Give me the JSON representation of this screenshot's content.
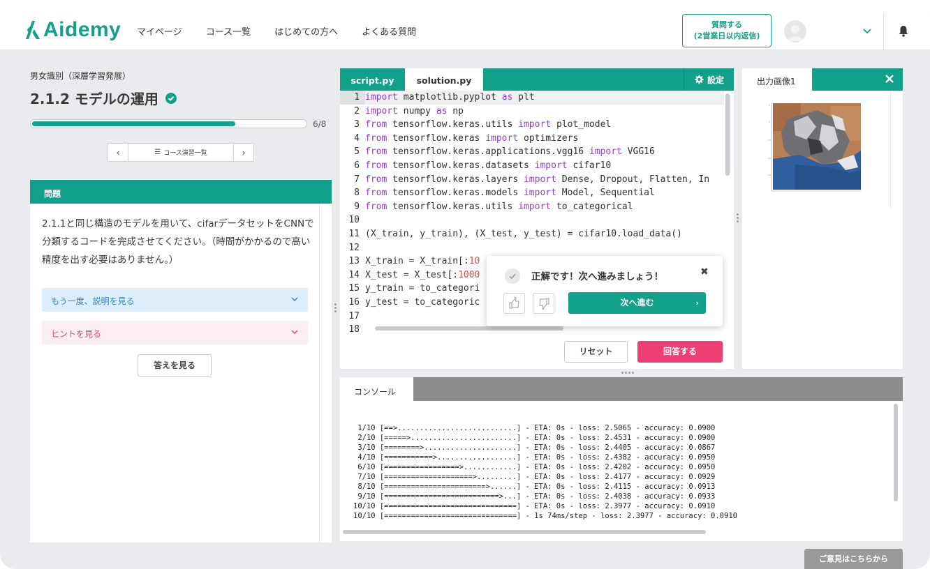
{
  "header": {
    "logo_text": "Aidemy",
    "nav": [
      "マイページ",
      "コース一覧",
      "はじめての方へ",
      "よくある質問"
    ],
    "ask_button": {
      "line1": "質問する",
      "line2": "(2営業日以内返信)"
    },
    "icons": {
      "user": "chevron-down-icon",
      "notify": "bell-icon"
    }
  },
  "lesson": {
    "breadcrumb": "男女識別（深層学習発展）",
    "title": "2.1.2 モデルの運用",
    "progress": {
      "current": 6,
      "total": 8,
      "label": "6/8",
      "fraction": 0.74
    },
    "pager": {
      "prev": "‹",
      "list_label": "コース演習一覧",
      "next": "›"
    }
  },
  "problem": {
    "heading": "問題",
    "text": "2.1.1と同じ構造のモデルを用いて、cifarデータセットをCNNで分類するコードを完成させてください。（時間がかかるので高い精度を出す必要はありません。）",
    "explain_label": "もう一度、説明を見る",
    "hint_label": "ヒントを見る",
    "answer_button": "答えを見る"
  },
  "editor": {
    "tabs": [
      "script.py",
      "solution.py"
    ],
    "settings_label": "設定",
    "lines": [
      {
        "n": "1",
        "segs": [
          [
            "kw",
            "import"
          ],
          [
            "plain",
            " matplotlib.pyplot "
          ],
          [
            "kw",
            "as"
          ],
          [
            "plain",
            " plt"
          ]
        ]
      },
      {
        "n": "2",
        "segs": [
          [
            "kw",
            "import"
          ],
          [
            "plain",
            " numpy "
          ],
          [
            "kw",
            "as"
          ],
          [
            "plain",
            " np"
          ]
        ]
      },
      {
        "n": "3",
        "segs": [
          [
            "kw",
            "from"
          ],
          [
            "plain",
            " tensorflow.keras.utils "
          ],
          [
            "kw",
            "import"
          ],
          [
            "plain",
            " plot_model"
          ]
        ]
      },
      {
        "n": "4",
        "segs": [
          [
            "kw",
            "from"
          ],
          [
            "plain",
            " tensorflow.keras "
          ],
          [
            "kw",
            "import"
          ],
          [
            "plain",
            " optimizers"
          ]
        ]
      },
      {
        "n": "5",
        "segs": [
          [
            "kw",
            "from"
          ],
          [
            "plain",
            " tensorflow.keras.applications.vgg16 "
          ],
          [
            "kw",
            "import"
          ],
          [
            "plain",
            " VGG16"
          ]
        ]
      },
      {
        "n": "6",
        "segs": [
          [
            "kw",
            "from"
          ],
          [
            "plain",
            " tensorflow.keras.datasets "
          ],
          [
            "kw",
            "import"
          ],
          [
            "plain",
            " cifar10"
          ]
        ]
      },
      {
        "n": "7",
        "segs": [
          [
            "kw",
            "from"
          ],
          [
            "plain",
            " tensorflow.keras.layers "
          ],
          [
            "kw",
            "import"
          ],
          [
            "plain",
            " Dense, Dropout, Flatten, In"
          ]
        ]
      },
      {
        "n": "8",
        "segs": [
          [
            "kw",
            "from"
          ],
          [
            "plain",
            " tensorflow.keras.models "
          ],
          [
            "kw",
            "import"
          ],
          [
            "plain",
            " Model, Sequential"
          ]
        ]
      },
      {
        "n": "9",
        "segs": [
          [
            "kw",
            "from"
          ],
          [
            "plain",
            " tensorflow.keras.utils "
          ],
          [
            "kw",
            "import"
          ],
          [
            "plain",
            " to_categorical"
          ]
        ]
      },
      {
        "n": "10",
        "segs": []
      },
      {
        "n": "11",
        "segs": [
          [
            "plain",
            "(X_train, y_train), (X_test, y_test) = cifar10.load_data()"
          ]
        ]
      },
      {
        "n": "12",
        "segs": []
      },
      {
        "n": "13",
        "segs": [
          [
            "plain",
            "X_train = X_train[:"
          ],
          [
            "num",
            "10"
          ]
        ]
      },
      {
        "n": "14",
        "segs": [
          [
            "plain",
            "X_test = X_test[:"
          ],
          [
            "num",
            "1000"
          ]
        ]
      },
      {
        "n": "15",
        "segs": [
          [
            "plain",
            "y_train = to_categori"
          ]
        ]
      },
      {
        "n": "16",
        "segs": [
          [
            "plain",
            "y_test = to_categoric"
          ]
        ]
      },
      {
        "n": "17",
        "segs": []
      },
      {
        "n": "18",
        "segs": []
      }
    ],
    "reset_button": "リセット",
    "submit_button": "回答する"
  },
  "popup": {
    "message": "正解です！次へ進みましょう！",
    "close": "✖",
    "next_button": "次へ進む",
    "next_chevron": "›"
  },
  "output": {
    "tab_label": "出力画像1",
    "image_description_icon": "output-image"
  },
  "console": {
    "tab_label": "コンソール",
    "log": [
      " 1/10 [==>...........................] - ETA: 0s - loss: 2.5065 - accuracy: 0.0900",
      " 2/10 [=====>........................] - ETA: 0s - loss: 2.4531 - accuracy: 0.0900",
      " 3/10 [========>.....................] - ETA: 0s - loss: 2.4405 - accuracy: 0.0867",
      " 4/10 [===========>..................] - ETA: 0s - loss: 2.4382 - accuracy: 0.0950",
      " 6/10 [=================>............] - ETA: 0s - loss: 2.4202 - accuracy: 0.0950",
      " 7/10 [====================>.........] - ETA: 0s - loss: 2.4177 - accuracy: 0.0929",
      " 8/10 [=======================>......] - ETA: 0s - loss: 2.4115 - accuracy: 0.0913",
      " 9/10 [==========================>...] - ETA: 0s - loss: 2.4038 - accuracy: 0.0933",
      "10/10 [==============================] - ETA: 0s - loss: 2.3977 - accuracy: 0.0910",
      "10/10 [==============================] - 1s 74ms/step - loss: 2.3977 - accuracy: 0.0910"
    ]
  },
  "feedback_button": "ご意見はこちらから",
  "colors": {
    "brand": "#12a08a",
    "danger": "#ec3f74",
    "info": "#2b84d6",
    "hint": "#e0456a"
  }
}
